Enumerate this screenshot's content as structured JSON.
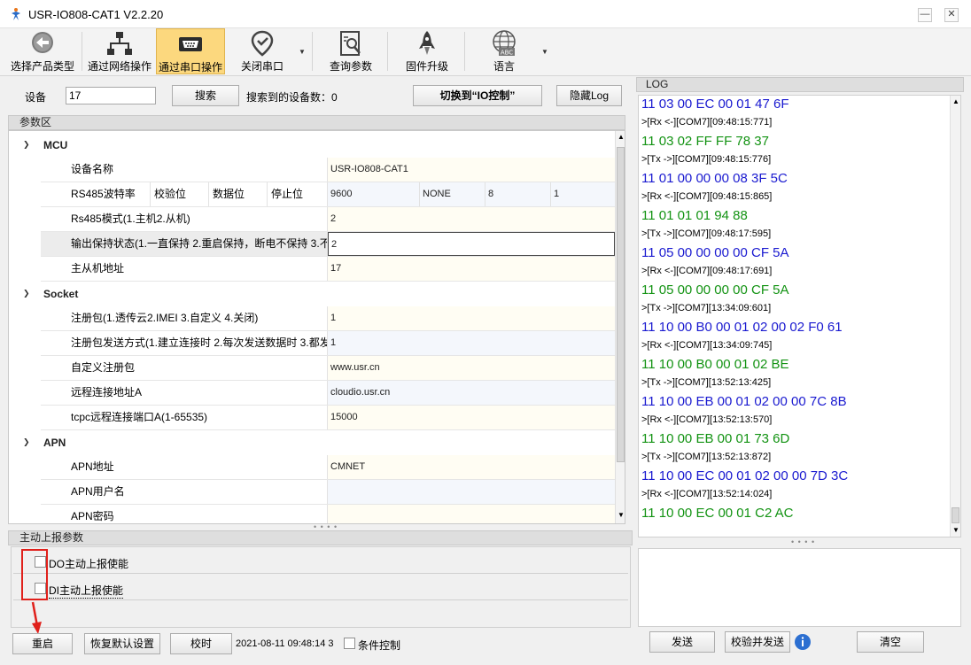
{
  "window": {
    "title": "USR-IO808-CAT1 V2.2.20",
    "minimize": "—",
    "close": "✕"
  },
  "toolbar": [
    {
      "label": "选择产品类型",
      "icon": "back-arrow-icon"
    },
    {
      "label": "通过网络操作",
      "icon": "network-icon"
    },
    {
      "label": "通过串口操作",
      "icon": "serial-port-icon",
      "active": true
    },
    {
      "label": "关闭串口",
      "icon": "location-pin-icon"
    },
    {
      "label": "查询参数",
      "icon": "search-document-icon"
    },
    {
      "label": "固件升级",
      "icon": "rocket-icon"
    },
    {
      "label": "语言",
      "icon": "globe-abc-icon",
      "badge": "ABC"
    }
  ],
  "topbar": {
    "device_label": "设备",
    "device_value": "17",
    "search_button": "搜索",
    "found_label": "搜索到的设备数：",
    "found_count": "0",
    "switch_button": "切换到“IO控制”",
    "hide_log_button": "隐藏Log"
  },
  "params": {
    "header": "参数区",
    "categories": [
      {
        "name": "MCU",
        "props": [
          {
            "name": "设备名称",
            "value": "USR-IO808-CAT1"
          },
          {
            "name": "RS485波特率",
            "subcols": [
              "校验位",
              "数据位",
              "停止位"
            ],
            "values": [
              "9600",
              "NONE",
              "8",
              "1"
            ]
          },
          {
            "name": "Rs485模式(1.主机2.从机)",
            "value": "2"
          },
          {
            "name": "输出保持状态(1.一直保持 2.重启保持，断电不保持 3.不",
            "value": "2",
            "selected": true
          },
          {
            "name": "主从机地址",
            "value": "17"
          }
        ]
      },
      {
        "name": "Socket",
        "props": [
          {
            "name": "注册包(1.透传云2.IMEI 3.自定义 4.关闭)",
            "value": "1"
          },
          {
            "name": "注册包发送方式(1.建立连接时 2.每次发送数据时 3.都发",
            "value": "1"
          },
          {
            "name": "自定义注册包",
            "value": "www.usr.cn"
          },
          {
            "name": "远程连接地址A",
            "value": "cloudio.usr.cn"
          },
          {
            "name": "tcpc远程连接端口A(1-65535)",
            "value": "15000"
          }
        ]
      },
      {
        "name": "APN",
        "props": [
          {
            "name": "APN地址",
            "value": "CMNET"
          },
          {
            "name": "APN用户名",
            "value": ""
          },
          {
            "name": "APN密码",
            "value": ""
          }
        ]
      }
    ]
  },
  "report": {
    "header": "主动上报参数",
    "items": [
      {
        "label": "DO主动上报使能"
      },
      {
        "label": "DI主动上报使能"
      }
    ]
  },
  "bottom": {
    "restart": "重启",
    "restore": "恢复默认设置",
    "timing": "校时",
    "datetime": "2021-08-11 09:48:14 3",
    "condition_label": "条件控制"
  },
  "log": {
    "header": "LOG",
    "lines": [
      {
        "kind": "hex",
        "dir": "tx",
        "text": "11 03 00 EC 00 01 47 6F"
      },
      {
        "kind": "meta",
        "text": ">[Rx <-][COM7][09:48:15:771]"
      },
      {
        "kind": "hex",
        "dir": "rx",
        "text": "11 03 02 FF FF 78 37"
      },
      {
        "kind": "meta",
        "text": ">[Tx ->][COM7][09:48:15:776]"
      },
      {
        "kind": "hex",
        "dir": "tx",
        "text": "11 01 00 00 00 08 3F 5C"
      },
      {
        "kind": "meta",
        "text": ">[Rx <-][COM7][09:48:15:865]"
      },
      {
        "kind": "hex",
        "dir": "rx",
        "text": "11 01 01 01 94 88"
      },
      {
        "kind": "meta",
        "text": ">[Tx ->][COM7][09:48:17:595]"
      },
      {
        "kind": "hex",
        "dir": "tx",
        "text": "11 05 00 00 00 00 CF 5A"
      },
      {
        "kind": "meta",
        "text": ">[Rx <-][COM7][09:48:17:691]"
      },
      {
        "kind": "hex",
        "dir": "rx",
        "text": "11 05 00 00 00 00 CF 5A"
      },
      {
        "kind": "meta",
        "text": ">[Tx ->][COM7][13:34:09:601]"
      },
      {
        "kind": "hex",
        "dir": "tx",
        "text": "11 10 00 B0 00 01 02 00 02 F0 61"
      },
      {
        "kind": "meta",
        "text": ">[Rx <-][COM7][13:34:09:745]"
      },
      {
        "kind": "hex",
        "dir": "rx",
        "text": "11 10 00 B0 00 01 02 BE"
      },
      {
        "kind": "meta",
        "text": ">[Tx ->][COM7][13:52:13:425]"
      },
      {
        "kind": "hex",
        "dir": "tx",
        "text": "11 10 00 EB 00 01 02 00 00 7C 8B"
      },
      {
        "kind": "meta",
        "text": ">[Rx <-][COM7][13:52:13:570]"
      },
      {
        "kind": "hex",
        "dir": "rx",
        "text": "11 10 00 EB 00 01 73 6D"
      },
      {
        "kind": "meta",
        "text": ">[Tx ->][COM7][13:52:13:872]"
      },
      {
        "kind": "hex",
        "dir": "tx",
        "text": "11 10 00 EC 00 01 02 00 00 7D 3C"
      },
      {
        "kind": "meta",
        "text": ">[Rx <-][COM7][13:52:14:024]"
      },
      {
        "kind": "hex",
        "dir": "rx",
        "text": "11 10 00 EC 00 01 C2 AC"
      }
    ],
    "send_button": "发送",
    "verify_send_button": "校验并发送",
    "clear_button": "清空",
    "colors": {
      "tx": "#1a1ad0",
      "rx": "#139313"
    }
  }
}
